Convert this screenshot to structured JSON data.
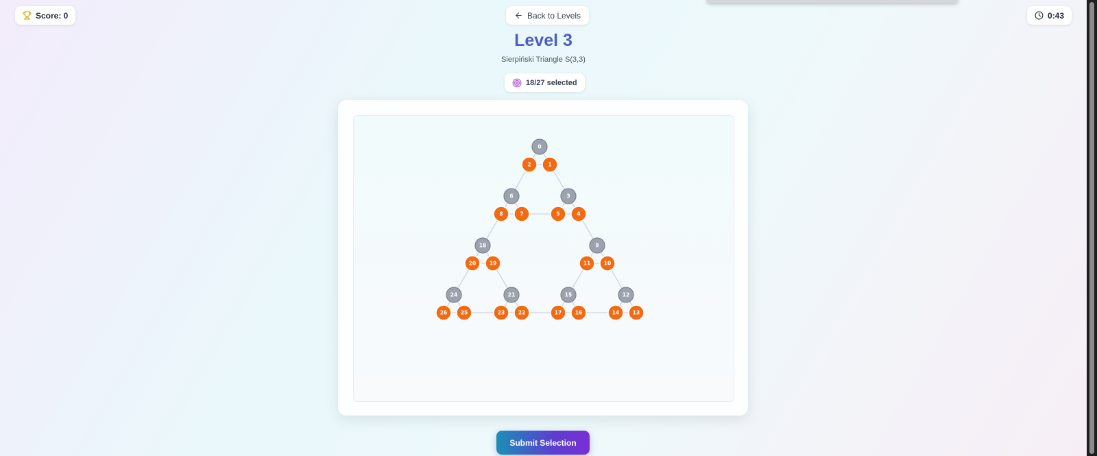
{
  "header": {
    "score_label": "Score: 0",
    "back_label": "Back to Levels",
    "timer": "0:43"
  },
  "level": {
    "title": "Level 3",
    "subtitle": "Sierpiński Triangle S(3,3)",
    "selected_text": "18/27 selected"
  },
  "submit_label": "Submit Selection",
  "colors": {
    "selected": "#f26a12",
    "unselected": "#9ca3af",
    "title": "#4a5fc1",
    "edge": "#d1d5db"
  },
  "nodes": [
    {
      "id": "0",
      "selected": false
    },
    {
      "id": "1",
      "selected": true
    },
    {
      "id": "2",
      "selected": true
    },
    {
      "id": "3",
      "selected": false
    },
    {
      "id": "4",
      "selected": true
    },
    {
      "id": "5",
      "selected": true
    },
    {
      "id": "6",
      "selected": false
    },
    {
      "id": "7",
      "selected": true
    },
    {
      "id": "8",
      "selected": true
    },
    {
      "id": "9",
      "selected": false
    },
    {
      "id": "10",
      "selected": true
    },
    {
      "id": "11",
      "selected": true
    },
    {
      "id": "12",
      "selected": false
    },
    {
      "id": "13",
      "selected": true
    },
    {
      "id": "14",
      "selected": true
    },
    {
      "id": "15",
      "selected": false
    },
    {
      "id": "16",
      "selected": true
    },
    {
      "id": "17",
      "selected": true
    },
    {
      "id": "18",
      "selected": false
    },
    {
      "id": "19",
      "selected": true
    },
    {
      "id": "20",
      "selected": true
    },
    {
      "id": "21",
      "selected": false
    },
    {
      "id": "22",
      "selected": true
    },
    {
      "id": "23",
      "selected": true
    },
    {
      "id": "24",
      "selected": false
    },
    {
      "id": "25",
      "selected": true
    },
    {
      "id": "26",
      "selected": true
    }
  ],
  "edges": [
    [
      "0",
      "1"
    ],
    [
      "0",
      "2"
    ],
    [
      "1",
      "2"
    ],
    [
      "3",
      "4"
    ],
    [
      "3",
      "5"
    ],
    [
      "4",
      "5"
    ],
    [
      "6",
      "7"
    ],
    [
      "6",
      "8"
    ],
    [
      "7",
      "8"
    ],
    [
      "1",
      "3"
    ],
    [
      "2",
      "6"
    ],
    [
      "5",
      "7"
    ],
    [
      "9",
      "10"
    ],
    [
      "9",
      "11"
    ],
    [
      "10",
      "11"
    ],
    [
      "12",
      "13"
    ],
    [
      "12",
      "14"
    ],
    [
      "13",
      "14"
    ],
    [
      "15",
      "16"
    ],
    [
      "15",
      "17"
    ],
    [
      "16",
      "17"
    ],
    [
      "10",
      "12"
    ],
    [
      "11",
      "15"
    ],
    [
      "14",
      "16"
    ],
    [
      "18",
      "19"
    ],
    [
      "18",
      "20"
    ],
    [
      "19",
      "20"
    ],
    [
      "21",
      "22"
    ],
    [
      "21",
      "23"
    ],
    [
      "22",
      "23"
    ],
    [
      "24",
      "25"
    ],
    [
      "24",
      "26"
    ],
    [
      "25",
      "26"
    ],
    [
      "19",
      "21"
    ],
    [
      "20",
      "24"
    ],
    [
      "23",
      "25"
    ],
    [
      "4",
      "9"
    ],
    [
      "8",
      "18"
    ],
    [
      "17",
      "22"
    ]
  ]
}
